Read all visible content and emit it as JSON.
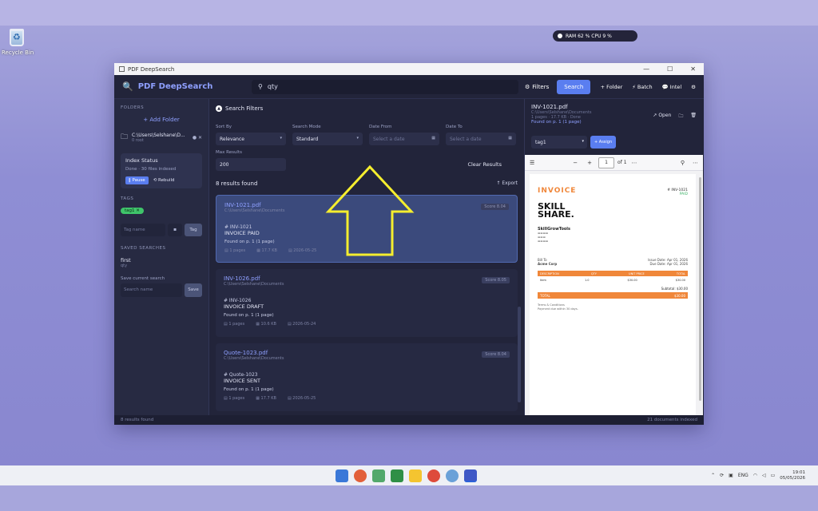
{
  "desktop": {
    "recycle_label": "Recycle Bin"
  },
  "perf": {
    "text": "RAM 62 %  CPU 9 %"
  },
  "window": {
    "title": "PDF DeepSearch",
    "ctrl_min": "—",
    "ctrl_max": "☐",
    "ctrl_close": "✕"
  },
  "toolbar": {
    "brand": "PDF DeepSearch",
    "query": "qty",
    "filters_label": "Filters",
    "search_label": "Search",
    "folder_label": "+ Folder",
    "batch_label": "⚡ Batch",
    "intel_label": "Intel"
  },
  "sidebar": {
    "folders_h": "FOLDERS",
    "add_folder": "+ Add Folder",
    "folder_path": "C:\\Users\\Selshane\\D...",
    "folder_sub": "0 root",
    "index_title": "Index Status",
    "index_detail": "Done · 30 files indexed",
    "pause": "‖ Pause",
    "rebuild": "⟲ Rebuild",
    "tags_h": "TAGS",
    "tag1": "tag1 ✕",
    "tag_placeholder": "Tag name",
    "tag_add": "Tag",
    "saved_h": "SAVED SEARCHES",
    "saved_name": "first",
    "saved_query": "qty",
    "save_current": "Save current search",
    "search_name_ph": "Search name",
    "save_btn": "Save"
  },
  "filters": {
    "title": "Search Filters",
    "sort_label": "Sort By",
    "sort_value": "Relevance",
    "mode_label": "Search Mode",
    "mode_value": "Standard",
    "from_label": "Date From",
    "from_ph": "Select a date",
    "to_label": "Date To",
    "to_ph": "Select a date",
    "max_label": "Max Results",
    "max_value": "200",
    "clear": "Clear Results"
  },
  "results": {
    "count": "8 results found",
    "export": "↑ Export",
    "items": [
      {
        "name": "INV-1021.pdf",
        "path": "C:\\Users\\Selshane\\Documents",
        "score": "Score 8.04",
        "h1": "# INV-1021",
        "h2": "INVOICE PAID",
        "found": "Found on p. 1 (1 page)",
        "pages": "1 pages",
        "size": "17.7 KB",
        "date": "2026-05-25"
      },
      {
        "name": "INV-1026.pdf",
        "path": "C:\\Users\\Selshane\\Documents",
        "score": "Score 8.05",
        "h1": "# INV-1026",
        "h2": "INVOICE DRAFT",
        "found": "Found on p. 1 (1 page)",
        "pages": "1 pages",
        "size": "10.6 KB",
        "date": "2026-05-24"
      },
      {
        "name": "Quote-1023.pdf",
        "path": "C:\\Users\\Selshane\\Documents",
        "score": "Score 8.04",
        "h1": "# Quote-1023",
        "h2": "INVOICE SENT",
        "found": "Found on p. 1 (1 page)",
        "pages": "1 pages",
        "size": "17.7 KB",
        "date": "2026-05-25"
      }
    ]
  },
  "preview": {
    "name": "INV-1021.pdf",
    "path": "C:\\Users\\Selshane\\Documents",
    "meta": "1 pages · 17.7 KB · Done",
    "found": "Found on p. 1 (1 page)",
    "open": "↗ Open",
    "tag_value": "tag1",
    "assign": "+ Assign",
    "page_num": "1",
    "page_of": "of 1",
    "doc": {
      "title": "INVOICE",
      "number": "# INV-1021",
      "status": "PAID",
      "brand1": "SKILL",
      "brand2": "SHARE.",
      "from": "SkillGrowTools",
      "bill_to": "Bill To",
      "client": "Acme Corp",
      "issue": "Issue Date: Apr 01, 2026",
      "due": "Due Date: Apr 01, 2026",
      "col1": "DESCRIPTION",
      "col2": "QTY",
      "col3": "UNIT PRICE",
      "col4": "TOTAL",
      "row_desc": "Item",
      "row_qty": "1.0",
      "row_price": "$30.00",
      "row_total": "$30.00",
      "subtotal": "Subtotal: $30.00",
      "total_label": "TOTAL",
      "total": "$30.00",
      "terms": "Terms & Conditions",
      "terms2": "Payment due within 30 days."
    }
  },
  "statusbar": {
    "left": "8 results found",
    "right": "21 documents indexed"
  },
  "tray": {
    "lang": "ENG",
    "time": "19:01",
    "date": "05/05/2026"
  }
}
